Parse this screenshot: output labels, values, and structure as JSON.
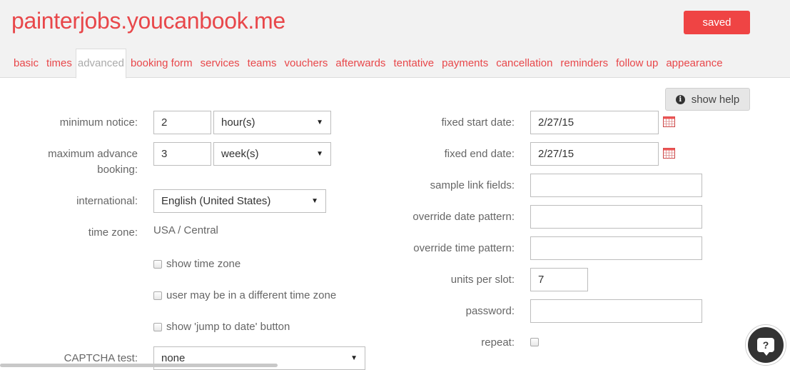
{
  "header": {
    "site_title": "painterjobs.youcanbook.me",
    "saved_label": "saved",
    "saved_color": "#ef4444"
  },
  "tabs": [
    {
      "label": "basic",
      "active": false
    },
    {
      "label": "times",
      "active": false
    },
    {
      "label": "advanced",
      "active": true
    },
    {
      "label": "booking form",
      "active": false
    },
    {
      "label": "services",
      "active": false
    },
    {
      "label": "teams",
      "active": false
    },
    {
      "label": "vouchers",
      "active": false
    },
    {
      "label": "afterwards",
      "active": false
    },
    {
      "label": "tentative",
      "active": false
    },
    {
      "label": "payments",
      "active": false
    },
    {
      "label": "cancellation",
      "active": false
    },
    {
      "label": "reminders",
      "active": false
    },
    {
      "label": "follow up",
      "active": false
    },
    {
      "label": "appearance",
      "active": false
    }
  ],
  "help": {
    "label": "show help",
    "icon": "info-icon"
  },
  "left": {
    "minimum_notice": {
      "label": "minimum notice:",
      "value": "2",
      "unit": "hour(s)"
    },
    "maximum_advance": {
      "label_line1": "maximum advance",
      "label_line2": "booking:",
      "value": "3",
      "unit": "week(s)"
    },
    "international": {
      "label": "international:",
      "value": "English (United States)"
    },
    "time_zone": {
      "label": "time zone:",
      "value": "USA / Central"
    },
    "checkboxes": [
      {
        "label": "show time zone",
        "checked": false
      },
      {
        "label": "user may be in a different time zone",
        "checked": false
      },
      {
        "label": "show 'jump to date' button",
        "checked": false
      }
    ],
    "captcha": {
      "label": "CAPTCHA test:",
      "value": "none"
    }
  },
  "right": {
    "fixed_start_date": {
      "label": "fixed start date:",
      "value": "2/27/15"
    },
    "fixed_end_date": {
      "label": "fixed end date:",
      "value": "2/27/15"
    },
    "sample_link_fields": {
      "label": "sample link fields:",
      "value": ""
    },
    "override_date_pattern": {
      "label": "override date pattern:",
      "value": ""
    },
    "override_time_pattern": {
      "label": "override time pattern:",
      "value": ""
    },
    "units_per_slot": {
      "label": "units per slot:",
      "value": "7"
    },
    "password": {
      "label": "password:",
      "value": ""
    },
    "repeat": {
      "label": "repeat:",
      "checked": false
    }
  },
  "chat": {
    "icon": "chat-help-icon",
    "glyph": "?"
  },
  "colors": {
    "accent": "#e8474a",
    "header_bg": "#f2f2f2"
  }
}
